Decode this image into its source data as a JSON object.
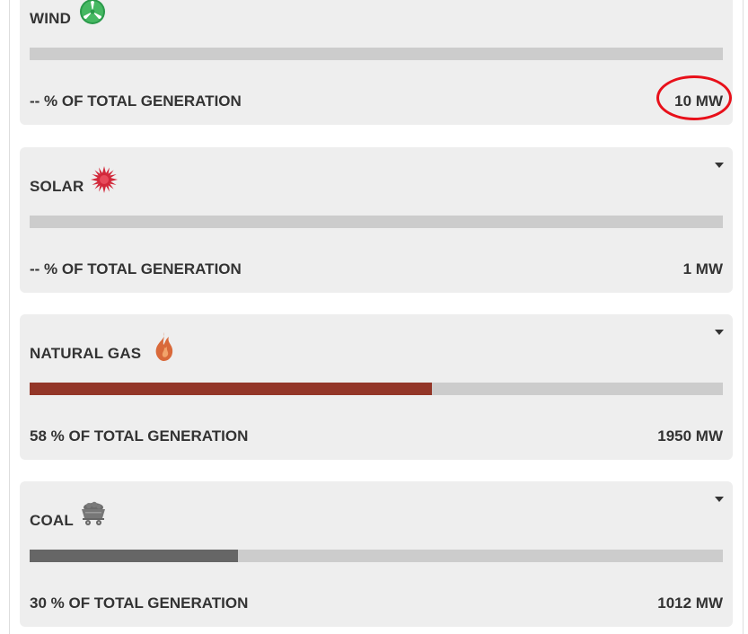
{
  "sources": [
    {
      "key": "wind",
      "name": "WIND",
      "icon": "wind-turbine-icon",
      "percent_label": "-- % OF TOTAL GENERATION",
      "percent_value": null,
      "output": "10 MW",
      "bar_color": "#2a9a4a"
    },
    {
      "key": "solar",
      "name": "SOLAR",
      "icon": "sun-icon",
      "percent_label": "-- % OF TOTAL GENERATION",
      "percent_value": null,
      "output": "1 MW",
      "bar_color": "#d2283a"
    },
    {
      "key": "natural-gas",
      "name": "NATURAL GAS",
      "icon": "flame-icon",
      "percent_label": "58 % OF TOTAL GENERATION",
      "percent_value": 58,
      "output": "1950 MW",
      "bar_color": "#933628"
    },
    {
      "key": "coal",
      "name": "COAL",
      "icon": "coal-cart-icon",
      "percent_label": "30 % OF TOTAL GENERATION",
      "percent_value": 30,
      "output": "1012 MW",
      "bar_color": "#666666"
    }
  ],
  "colors": {
    "card_background": "#eeeeee",
    "bar_track": "#cccccc",
    "text": "#333333",
    "highlight_ring": "#e8101a"
  }
}
